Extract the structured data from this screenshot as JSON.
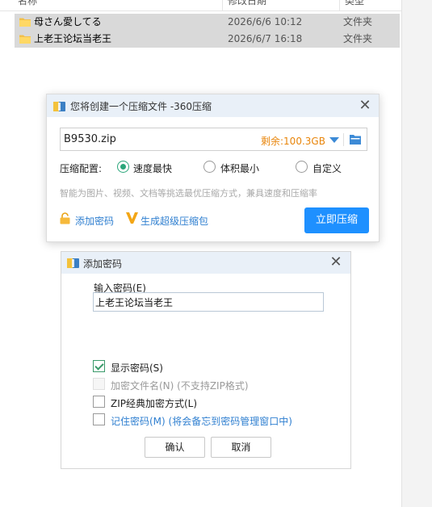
{
  "explorer": {
    "headers": {
      "name": "名称",
      "date": "修改日期",
      "type": "类型"
    },
    "files": [
      {
        "name": "母さん愛してる",
        "date": "2026/6/6 10:12",
        "type": "文件夹"
      },
      {
        "name": "上老王论坛当老王",
        "date": "2026/6/7 16:18",
        "type": "文件夹"
      }
    ]
  },
  "compress_dialog": {
    "title": "您将创建一个压缩文件 -360压缩",
    "filename": "B9530.zip",
    "remaining": "剩余:100.3GB",
    "config_label": "压缩配置:",
    "options": [
      {
        "label": "速度最快",
        "selected": true
      },
      {
        "label": "体积最小",
        "selected": false
      },
      {
        "label": "自定义",
        "selected": false
      }
    ],
    "hint": "智能为图片、视频、文档等挑选最优压缩方式，兼具速度和压缩率",
    "add_password": "添加密码",
    "super_pack": "生成超级压缩包",
    "compress_button": "立即压缩"
  },
  "password_dialog": {
    "title": "添加密码",
    "input_label": "输入密码(E)",
    "password_value": "上老王论坛当老王",
    "options": [
      {
        "label": "显示密码(S)",
        "checked": true,
        "enabled": true
      },
      {
        "label": "加密文件名(N) (不支持ZIP格式)",
        "checked": false,
        "enabled": false
      },
      {
        "label": "ZIP经典加密方式(L)",
        "checked": false,
        "enabled": true
      },
      {
        "label": "记住密码(M) (将会备忘到密码管理窗口中)",
        "checked": false,
        "enabled": true
      }
    ],
    "ok_button": "确认",
    "cancel_button": "取消"
  },
  "colors": {
    "accent_blue": "#1e90ff",
    "link_blue": "#2f7fd0",
    "remaining_orange": "#e8850a",
    "radio_green": "#2aa67a",
    "titlebar_bg": "#e9f0f8"
  }
}
